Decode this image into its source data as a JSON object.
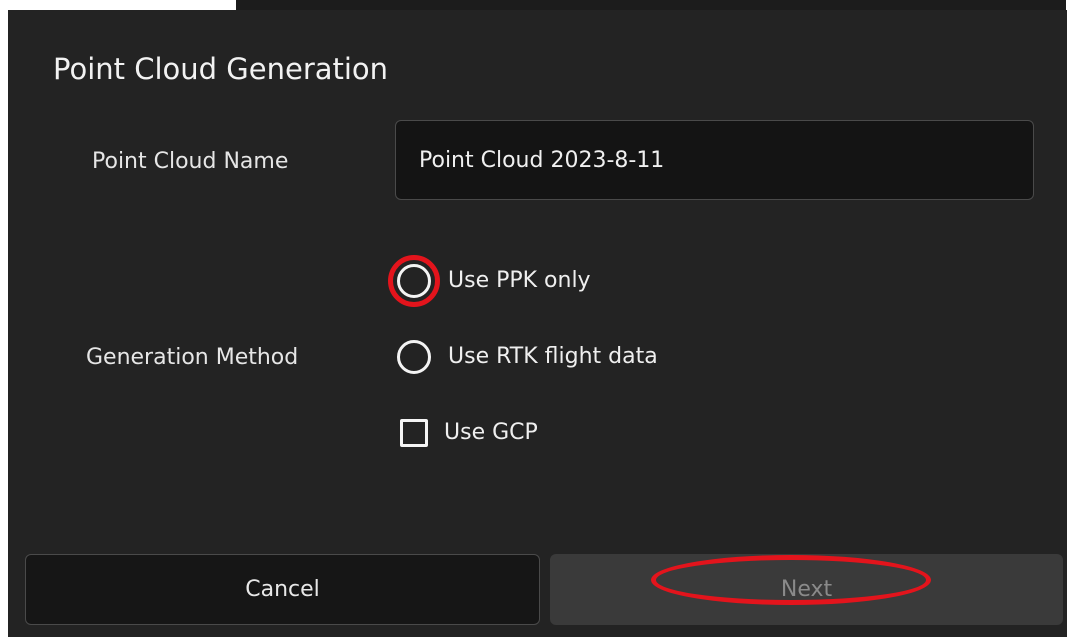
{
  "dialog": {
    "title": "Point Cloud Generation",
    "point_cloud_name_label": "Point Cloud Name",
    "point_cloud_name_value": "Point Cloud 2023-8-11",
    "generation_method_label": "Generation Method",
    "options": {
      "ppk": "Use PPK only",
      "rtk": "Use RTK flight data",
      "gcp": "Use GCP"
    },
    "buttons": {
      "cancel": "Cancel",
      "next": "Next"
    }
  },
  "colors": {
    "background": "#232323",
    "highlight": "#e3141c",
    "disabled_button": "#3a3a3a"
  },
  "state": {
    "ppk_selected": false,
    "rtk_selected": false,
    "gcp_checked": false,
    "next_enabled": false
  }
}
